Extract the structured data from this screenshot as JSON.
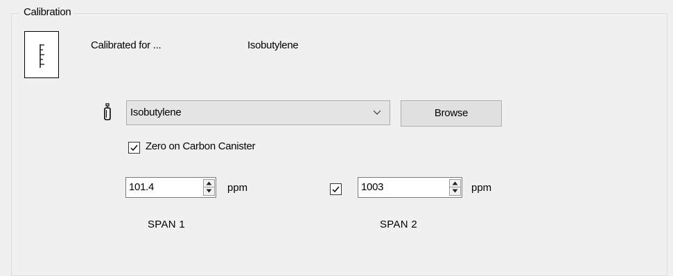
{
  "calibration": {
    "group_title": "Calibration",
    "calibrated_for_label": "Calibrated for ...",
    "calibrated_gas": "Isobutylene",
    "gas_select": {
      "selected": "Isobutylene"
    },
    "browse_label": "Browse",
    "zero_on_carbon": {
      "label": "Zero on Carbon Canister",
      "checked": true
    },
    "span1": {
      "value": "101.4",
      "unit": "ppm",
      "label": "SPAN 1"
    },
    "span2": {
      "enabled": true,
      "value": "1003",
      "unit": "ppm",
      "label": "SPAN 2"
    }
  },
  "icons": {
    "calibration": "ruler-icon",
    "gas": "gas-cylinder-icon",
    "dropdown": "chevron-down-icon",
    "check": "checkmark-icon",
    "spin_up": "triangle-up-icon",
    "spin_down": "triangle-down-icon"
  }
}
